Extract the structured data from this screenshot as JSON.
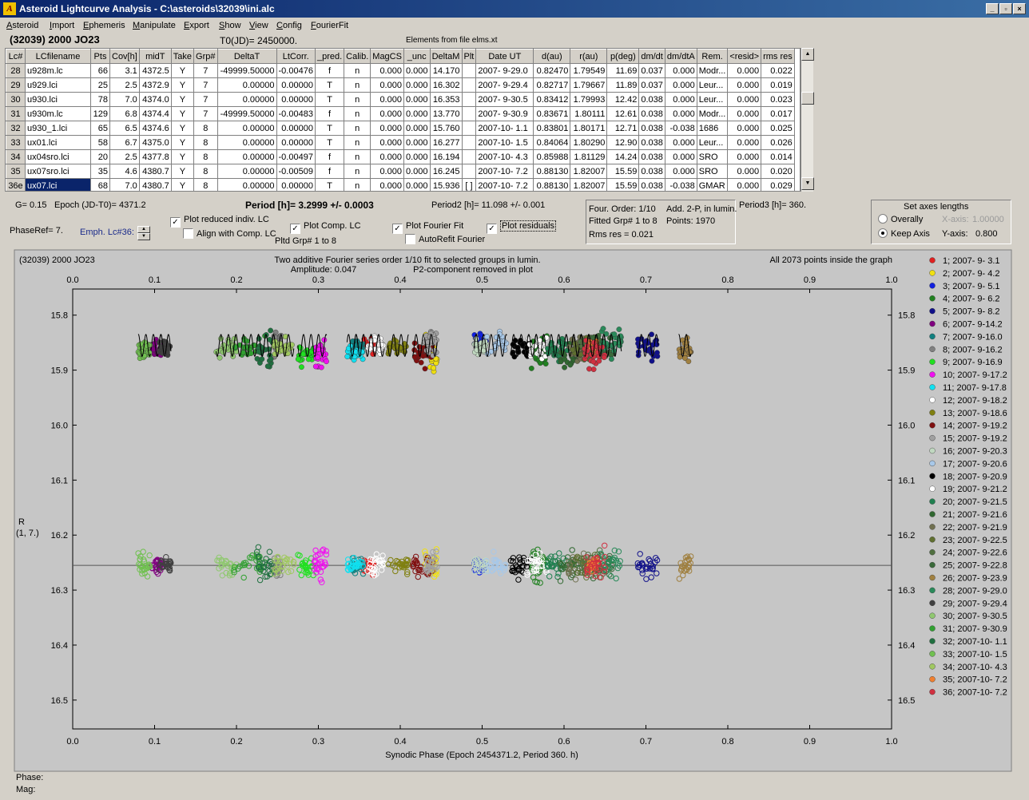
{
  "window": {
    "title": "Asteroid Lightcurve Analysis - C:\\asteroids\\32039\\ini.alc",
    "min": "_",
    "max": "▫",
    "close": "×"
  },
  "menu": [
    "Asteroid",
    "Import",
    "Ephemeris",
    "Manipulate",
    "Export",
    "Show",
    "View",
    "Config",
    "FourierFit"
  ],
  "header": {
    "object": "(32039) 2000 JO23",
    "t0": "T0(JD)= 2450000.",
    "elements": "Elements from file elms.xt"
  },
  "table": {
    "columns": [
      "Lc#",
      "LCfilename",
      "Pts",
      "Cov[h]",
      "midT",
      "Take",
      "Grp#",
      "DeltaT",
      "LtCorr.",
      "_pred.",
      "Calib.",
      "MagCS",
      "_unc",
      "DeltaM",
      "Plt",
      "Date UT",
      "d(au)",
      "r(au)",
      "p(deg)",
      "dm/dt",
      "dm/dtA",
      "Rem.",
      "<resid>",
      "rms res"
    ],
    "rows": [
      [
        "28",
        "u928m.lc",
        "66",
        "3.1",
        "4372.5",
        "Y",
        "7",
        "-49999.50000",
        "-0.00476",
        "f",
        "n",
        "0.000",
        "0.000",
        "14.170",
        "",
        "2007- 9-29.0",
        "0.82470",
        "1.79549",
        "11.69",
        "0.037",
        "0.000",
        "Modr...",
        "0.000",
        "0.022"
      ],
      [
        "29",
        "u929.lci",
        "25",
        "2.5",
        "4372.9",
        "Y",
        "7",
        "0.00000",
        "0.00000",
        "T",
        "n",
        "0.000",
        "0.000",
        "16.302",
        "",
        "2007- 9-29.4",
        "0.82717",
        "1.79667",
        "11.89",
        "0.037",
        "0.000",
        "Leur...",
        "0.000",
        "0.019"
      ],
      [
        "30",
        "u930.lci",
        "78",
        "7.0",
        "4374.0",
        "Y",
        "7",
        "0.00000",
        "0.00000",
        "T",
        "n",
        "0.000",
        "0.000",
        "16.353",
        "",
        "2007- 9-30.5",
        "0.83412",
        "1.79993",
        "12.42",
        "0.038",
        "0.000",
        "Leur...",
        "0.000",
        "0.023"
      ],
      [
        "31",
        "u930m.lc",
        "129",
        "6.8",
        "4374.4",
        "Y",
        "7",
        "-49999.50000",
        "-0.00483",
        "f",
        "n",
        "0.000",
        "0.000",
        "13.770",
        "",
        "2007- 9-30.9",
        "0.83671",
        "1.80111",
        "12.61",
        "0.038",
        "0.000",
        "Modr...",
        "0.000",
        "0.017"
      ],
      [
        "32",
        "u930_1.lci",
        "65",
        "6.5",
        "4374.6",
        "Y",
        "8",
        "0.00000",
        "0.00000",
        "T",
        "n",
        "0.000",
        "0.000",
        "15.760",
        "",
        "2007-10- 1.1",
        "0.83801",
        "1.80171",
        "12.71",
        "0.038",
        "-0.038",
        "1686",
        "0.000",
        "0.025"
      ],
      [
        "33",
        "ux01.lci",
        "58",
        "6.7",
        "4375.0",
        "Y",
        "8",
        "0.00000",
        "0.00000",
        "T",
        "n",
        "0.000",
        "0.000",
        "16.277",
        "",
        "2007-10- 1.5",
        "0.84064",
        "1.80290",
        "12.90",
        "0.038",
        "0.000",
        "Leur...",
        "0.000",
        "0.026"
      ],
      [
        "34",
        "ux04sro.lci",
        "20",
        "2.5",
        "4377.8",
        "Y",
        "8",
        "0.00000",
        "-0.00497",
        "f",
        "n",
        "0.000",
        "0.000",
        "16.194",
        "",
        "2007-10- 4.3",
        "0.85988",
        "1.81129",
        "14.24",
        "0.038",
        "0.000",
        "SRO",
        "0.000",
        "0.014"
      ],
      [
        "35",
        "ux07sro.lci",
        "35",
        "4.6",
        "4380.7",
        "Y",
        "8",
        "0.00000",
        "-0.00509",
        "f",
        "n",
        "0.000",
        "0.000",
        "16.245",
        "",
        "2007-10- 7.2",
        "0.88130",
        "1.82007",
        "15.59",
        "0.038",
        "0.000",
        "SRO",
        "0.000",
        "0.020"
      ],
      [
        "36e",
        "ux07.lci",
        "68",
        "7.0",
        "4380.7",
        "Y",
        "8",
        "0.00000",
        "0.00000",
        "T",
        "n",
        "0.000",
        "0.000",
        "15.936",
        "[ ]",
        "2007-10- 7.2",
        "0.88130",
        "1.82007",
        "15.59",
        "0.038",
        "-0.038",
        "GMAR",
        "0.000",
        "0.029"
      ]
    ]
  },
  "info": {
    "g": "G= 0.15",
    "epoch": "Epoch (JD-T0)= 4371.2",
    "period": "Period [h]= 3.2999 +/- 0.0003",
    "period2": "Period2 [h]= 11.098 +/- 0.001",
    "period3": "Period3 [h]= 360.",
    "phaseref": "PhaseRef= 7.",
    "emph": "Emph. Lc#36:",
    "four_order": "Four. Order:  1/10",
    "add2p": "Add. 2-P, in lumin.",
    "fitted": "Fitted Grp# 1 to 8",
    "points": "Points: 1970",
    "rms": "Rms res     = 0.021",
    "pltd": "Pltd Grp#  1   to    8"
  },
  "checks": {
    "reduced": "Plot reduced indiv. LC",
    "align": "Align with Comp. LC",
    "comp": "Plot Comp. LC",
    "fourier": "Plot Fourier Fit",
    "autorefit": "AutoRefit Fourier",
    "resid": "Plot residuals",
    "mark": "✓"
  },
  "axes": {
    "title": "Set axes lengths",
    "overally": "Overally",
    "keep": "Keep Axis",
    "xaxis": "X-axis:",
    "xval": "1.00000",
    "yaxis": "Y-axis:",
    "yval": "0.800"
  },
  "footer": {
    "phase": "Phase:",
    "mag": "Mag:"
  },
  "chart_data": {
    "type": "scatter",
    "title": "(32039) 2000 JO23",
    "subtitle": [
      "Two additive Fourier series order 1/10 fit to selected groups in lumin.",
      "Amplitude: 0.047",
      "P2-component removed in plot"
    ],
    "note": "All 2073 points inside the graph",
    "xlabel": "Synodic Phase (Epoch 2454371.2, Period 360. h)",
    "ylabel": [
      "R",
      "(1, 7.)"
    ],
    "xlim": [
      0.0,
      1.0
    ],
    "ylim": [
      15.75,
      16.55
    ],
    "y_inverted": true,
    "xticks": [
      "0.0",
      "0.1",
      "0.2",
      "0.3",
      "0.4",
      "0.5",
      "0.6",
      "0.7",
      "0.8",
      "0.9",
      "1.0"
    ],
    "yticks": [
      "15.8",
      "15.9",
      "16.0",
      "16.1",
      "16.2",
      "16.3",
      "16.4",
      "16.5"
    ],
    "residual_offset": 0.4,
    "residual_baseline": 16.255,
    "fourier_mean": 15.855,
    "fourier_amplitude": 0.02,
    "series": [
      {
        "name": "1; 2007- 9- 3.1",
        "color": "#e02020",
        "x": [
          0.355,
          0.368
        ],
        "y": 15.855,
        "spread": 0.02
      },
      {
        "name": "2; 2007- 9- 4.2",
        "color": "#f0e010",
        "x": [
          0.43,
          0.445
        ],
        "y": 15.87,
        "spread": 0.04
      },
      {
        "name": "3; 2007- 9- 5.1",
        "color": "#1020e0",
        "x": [
          0.49,
          0.505
        ],
        "y": 15.85,
        "spread": 0.02
      },
      {
        "name": "4; 2007- 9- 6.2",
        "color": "#208020",
        "x": [
          0.56,
          0.58
        ],
        "y": 15.87,
        "spread": 0.04
      },
      {
        "name": "5; 2007- 9- 8.2",
        "color": "#10108a",
        "x": [
          0.69,
          0.715
        ],
        "y": 15.86,
        "spread": 0.03
      },
      {
        "name": "6; 2007- 9-14.2",
        "color": "#800080",
        "x": [
          0.095,
          0.11
        ],
        "y": 15.86,
        "spread": 0.02
      },
      {
        "name": "7; 2007- 9-16.0",
        "color": "#108080",
        "x": [
          0.34,
          0.355
        ],
        "y": 15.86,
        "spread": 0.02
      },
      {
        "name": "8; 2007- 9-16.2",
        "color": "#808080",
        "x": [
          0.245,
          0.255
        ],
        "y": 15.85,
        "spread": 0.03
      },
      {
        "name": "9; 2007- 9-16.9",
        "color": "#20e020",
        "x": [
          0.275,
          0.295
        ],
        "y": 15.87,
        "spread": 0.03
      },
      {
        "name": "10; 2007- 9-17.2",
        "color": "#f010f0",
        "x": [
          0.295,
          0.31
        ],
        "y": 15.87,
        "spread": 0.04
      },
      {
        "name": "11; 2007- 9-17.8",
        "color": "#10e0f0",
        "x": [
          0.335,
          0.355
        ],
        "y": 15.87,
        "spread": 0.02
      },
      {
        "name": "12; 2007- 9-18.2",
        "color": "#ffffff",
        "x": [
          0.36,
          0.38
        ],
        "y": 15.85,
        "spread": 0.03
      },
      {
        "name": "13; 2007- 9-18.6",
        "color": "#808010",
        "x": [
          0.385,
          0.41
        ],
        "y": 15.86,
        "spread": 0.02
      },
      {
        "name": "14; 2007- 9-19.2",
        "color": "#801010",
        "x": [
          0.415,
          0.44
        ],
        "y": 15.87,
        "spread": 0.03
      },
      {
        "name": "15; 2007- 9-19.2",
        "color": "#a0a0a0",
        "x": [
          0.43,
          0.445
        ],
        "y": 15.85,
        "spread": 0.03
      },
      {
        "name": "16; 2007- 9-20.3",
        "color": "#c0d8c0",
        "x": [
          0.49,
          0.505
        ],
        "y": 15.86,
        "spread": 0.02
      },
      {
        "name": "17; 2007- 9-20.6",
        "color": "#a8c8e8",
        "x": [
          0.505,
          0.53
        ],
        "y": 15.85,
        "spread": 0.03
      },
      {
        "name": "18; 2007- 9-20.9",
        "color": "#000000",
        "x": [
          0.535,
          0.56
        ],
        "y": 15.86,
        "spread": 0.03
      },
      {
        "name": "19; 2007- 9-21.2",
        "color": "#ffffff",
        "x": [
          0.555,
          0.58
        ],
        "y": 15.86,
        "spread": 0.03
      },
      {
        "name": "20; 2007- 9-21.5",
        "color": "#208050",
        "x": [
          0.58,
          0.605
        ],
        "y": 15.86,
        "spread": 0.03
      },
      {
        "name": "21; 2007- 9-21.6",
        "color": "#306830",
        "x": [
          0.595,
          0.62
        ],
        "y": 15.87,
        "spread": 0.04
      },
      {
        "name": "22; 2007- 9-21.9",
        "color": "#707050",
        "x": [
          0.605,
          0.635
        ],
        "y": 15.86,
        "spread": 0.03
      },
      {
        "name": "23; 2007- 9-22.5",
        "color": "#607030",
        "x": [
          0.61,
          0.64
        ],
        "y": 15.86,
        "spread": 0.03
      },
      {
        "name": "24; 2007- 9-22.6",
        "color": "#507040",
        "x": [
          0.62,
          0.645
        ],
        "y": 15.86,
        "spread": 0.03
      },
      {
        "name": "25; 2007- 9-22.8",
        "color": "#3a6a3a",
        "x": [
          0.635,
          0.66
        ],
        "y": 15.86,
        "spread": 0.03
      },
      {
        "name": "26; 2007- 9-23.9",
        "color": "#a08040",
        "x": [
          0.74,
          0.755
        ],
        "y": 15.86,
        "spread": 0.03
      },
      {
        "name": "28; 2007- 9-29.0",
        "color": "#2a8a5a",
        "x": [
          0.645,
          0.67
        ],
        "y": 15.85,
        "spread": 0.04
      },
      {
        "name": "29; 2007- 9-29.4",
        "color": "#404040",
        "x": [
          0.105,
          0.12
        ],
        "y": 15.86,
        "spread": 0.02
      },
      {
        "name": "30; 2007- 9-30.5",
        "color": "#90c870",
        "x": [
          0.175,
          0.2
        ],
        "y": 15.86,
        "spread": 0.03
      },
      {
        "name": "31; 2007- 9-30.9",
        "color": "#30a030",
        "x": [
          0.195,
          0.235
        ],
        "y": 15.86,
        "spread": 0.03
      },
      {
        "name": "32; 2007-10- 1.1",
        "color": "#207040",
        "x": [
          0.225,
          0.245
        ],
        "y": 15.87,
        "spread": 0.05
      },
      {
        "name": "33; 2007-10- 1.5",
        "color": "#70c050",
        "x": [
          0.08,
          0.095
        ],
        "y": 15.86,
        "spread": 0.03
      },
      {
        "name": "34; 2007-10- 4.3",
        "color": "#a0c860",
        "x": [
          0.245,
          0.27
        ],
        "y": 15.86,
        "spread": 0.03
      },
      {
        "name": "35; 2007-10- 7.2",
        "color": "#f08030",
        "x": [
          0.63,
          0.64
        ],
        "y": 15.86,
        "spread": 0.02
      },
      {
        "name": "36; 2007-10- 7.2",
        "color": "#d03040",
        "x": [
          0.625,
          0.65
        ],
        "y": 15.87,
        "spread": 0.04
      }
    ]
  }
}
